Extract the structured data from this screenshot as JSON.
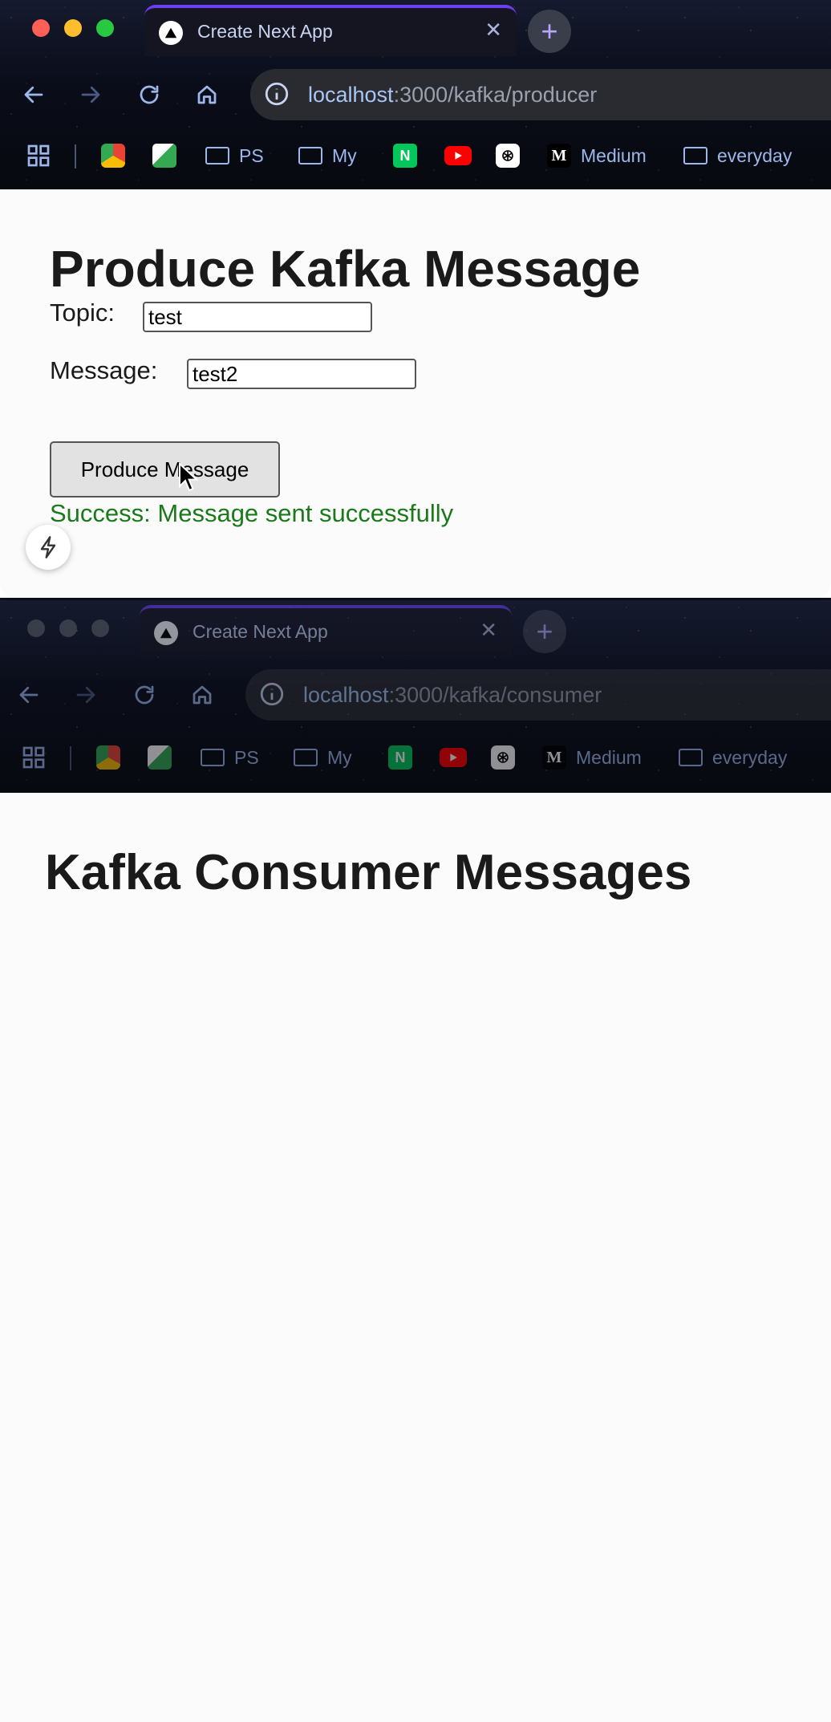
{
  "producer_window": {
    "tab_title": "Create Next App",
    "url_host": "localhost",
    "url_path": ":3000/kafka/producer",
    "heading": "Produce Kafka Message",
    "topic_label": "Topic:",
    "topic_value": "test",
    "message_label": "Message:",
    "message_value": "test2",
    "button_label": "Produce Message",
    "status": "Success: Message sent successfully"
  },
  "consumer_window": {
    "tab_title": "Create Next App",
    "url_host": "localhost",
    "url_path": ":3000/kafka/consumer",
    "heading": "Kafka Consumer Messages"
  },
  "bookmarks": {
    "ps": "PS",
    "my": "My",
    "naver_letter": "N",
    "medium_logo": "M",
    "medium": "Medium",
    "everyday": "everyday"
  },
  "colors": {
    "success": "#1a7a1a",
    "tab_accent": "#6d3ff0",
    "url_host": "#a9c6f4"
  }
}
